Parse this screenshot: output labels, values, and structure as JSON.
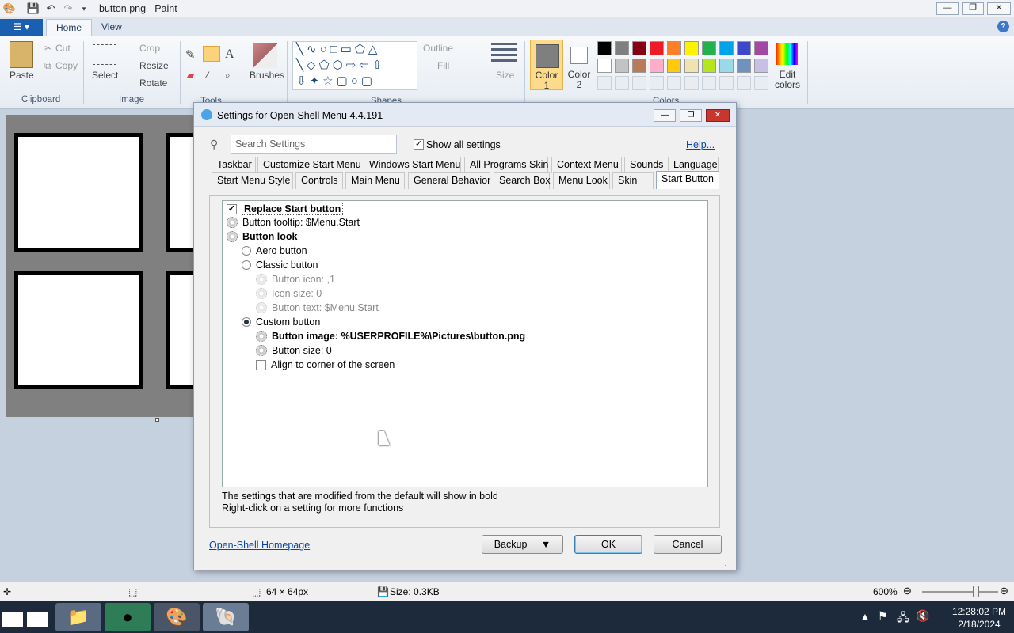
{
  "paint": {
    "title": "button.png - Paint",
    "tabs": [
      "Home",
      "View"
    ],
    "clipboard": {
      "paste": "Paste",
      "cut": "Cut",
      "copy": "Copy",
      "group": "Clipboard"
    },
    "image": {
      "select": "Select",
      "crop": "Crop",
      "resize": "Resize",
      "rotate": "Rotate",
      "group": "Image"
    },
    "tools": {
      "group": "Tools",
      "brushes": "Brushes"
    },
    "shapes": {
      "outline": "Outline",
      "fill": "Fill",
      "group": "Shapes"
    },
    "size": "Size",
    "color1": [
      "Color",
      "1"
    ],
    "color2": [
      "Color",
      "2"
    ],
    "colors_group": "Colors",
    "edit_colors": [
      "Edit",
      "colors"
    ],
    "palette_row1": [
      "#000000",
      "#7f7f7f",
      "#880015",
      "#ed1c24",
      "#ff7f27",
      "#fff200",
      "#22b14c",
      "#00a2e8",
      "#3f48cc",
      "#a349a4"
    ],
    "palette_row2": [
      "#ffffff",
      "#c3c3c3",
      "#b97a57",
      "#ffaec9",
      "#ffc90e",
      "#efe4b0",
      "#b5e61d",
      "#99d9ea",
      "#7092be",
      "#c8bfe7"
    ],
    "status": {
      "dimensions": "64 × 64px",
      "size": "Size: 0.3KB",
      "zoom": "600%"
    }
  },
  "dialog": {
    "title": "Settings for Open-Shell Menu 4.4.191",
    "search_placeholder": "Search Settings",
    "show_all": "Show all settings",
    "help": "Help...",
    "tabs_row1": [
      "Taskbar",
      "Customize Start Menu",
      "Windows Start Menu",
      "All Programs Skin",
      "Context Menu",
      "Sounds",
      "Language"
    ],
    "tabs_row2": [
      "Start Menu Style",
      "Controls",
      "Main Menu",
      "General Behavior",
      "Search Box",
      "Menu Look",
      "Skin",
      "Start Button"
    ],
    "settings": [
      {
        "text": "Replace Start button",
        "kind": "check",
        "checked": true,
        "bold": true
      },
      {
        "text": "Button tooltip: $Menu.Start",
        "kind": "gear"
      },
      {
        "text": "Button look",
        "kind": "gear",
        "bold": true
      },
      {
        "text": "Aero button",
        "kind": "radio"
      },
      {
        "text": "Classic button",
        "kind": "radio"
      },
      {
        "text": "Button icon: ,1",
        "kind": "gear",
        "dim": true
      },
      {
        "text": "Icon size: 0",
        "kind": "gear",
        "dim": true
      },
      {
        "text": "Button text: $Menu.Start",
        "kind": "gear",
        "dim": true
      },
      {
        "text": "Custom button",
        "kind": "radio",
        "checked": true
      },
      {
        "text": "Button image: %USERPROFILE%\\Pictures\\button.png",
        "kind": "gear",
        "bold": true
      },
      {
        "text": "Button size: 0",
        "kind": "gear"
      },
      {
        "text": "Align to corner of the screen",
        "kind": "check",
        "checked": false
      }
    ],
    "info1": "The settings that are modified from the default will show in bold",
    "info2": "Right-click on a setting for more functions",
    "homepage": "Open-Shell Homepage",
    "backup": "Backup",
    "ok": "OK",
    "cancel": "Cancel"
  },
  "taskbar": {
    "time": "12:28:02 PM",
    "date": "2/18/2024"
  }
}
